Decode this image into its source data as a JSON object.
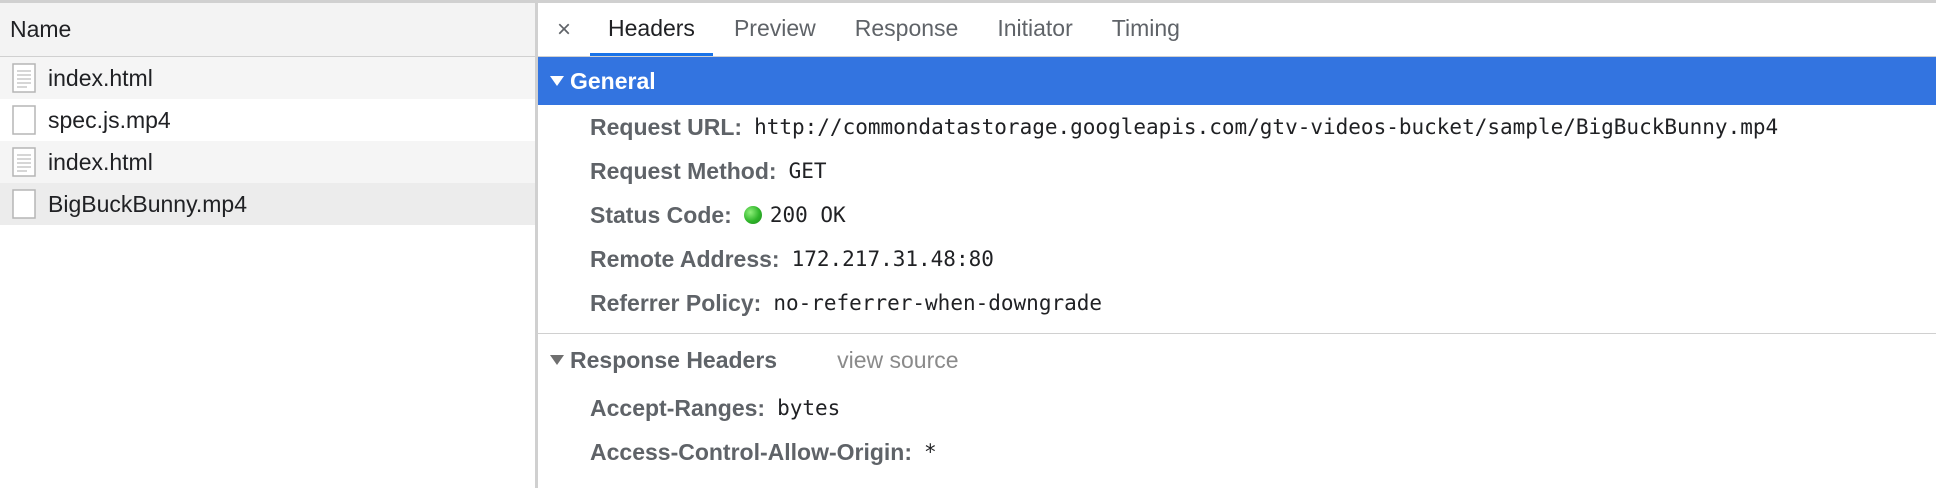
{
  "list": {
    "header": "Name",
    "items": [
      {
        "name": "index.html",
        "icon": "document-icon"
      },
      {
        "name": "spec.js.mp4",
        "icon": "blank-file-icon"
      },
      {
        "name": "index.html",
        "icon": "document-icon"
      },
      {
        "name": "BigBuckBunny.mp4",
        "icon": "blank-file-icon"
      }
    ]
  },
  "tabs": {
    "close_glyph": "×",
    "items": [
      "Headers",
      "Preview",
      "Response",
      "Initiator",
      "Timing"
    ],
    "active": "Headers"
  },
  "general": {
    "title": "General",
    "rows": [
      {
        "key": "Request URL:",
        "value": "http://commondatastorage.googleapis.com/gtv-videos-bucket/sample/BigBuckBunny.mp4"
      },
      {
        "key": "Request Method:",
        "value": "GET"
      },
      {
        "key": "Status Code:",
        "value": "200 OK"
      },
      {
        "key": "Remote Address:",
        "value": "172.217.31.48:80"
      },
      {
        "key": "Referrer Policy:",
        "value": "no-referrer-when-downgrade"
      }
    ]
  },
  "response_headers": {
    "title": "Response Headers",
    "view_source": "view source",
    "rows": [
      {
        "key": "Accept-Ranges:",
        "value": "bytes"
      },
      {
        "key": "Access-Control-Allow-Origin:",
        "value": "*"
      }
    ]
  },
  "colors": {
    "accent": "#3374e0",
    "tab_underline": "#1a73e8",
    "status_ok": "#2fb52a"
  }
}
